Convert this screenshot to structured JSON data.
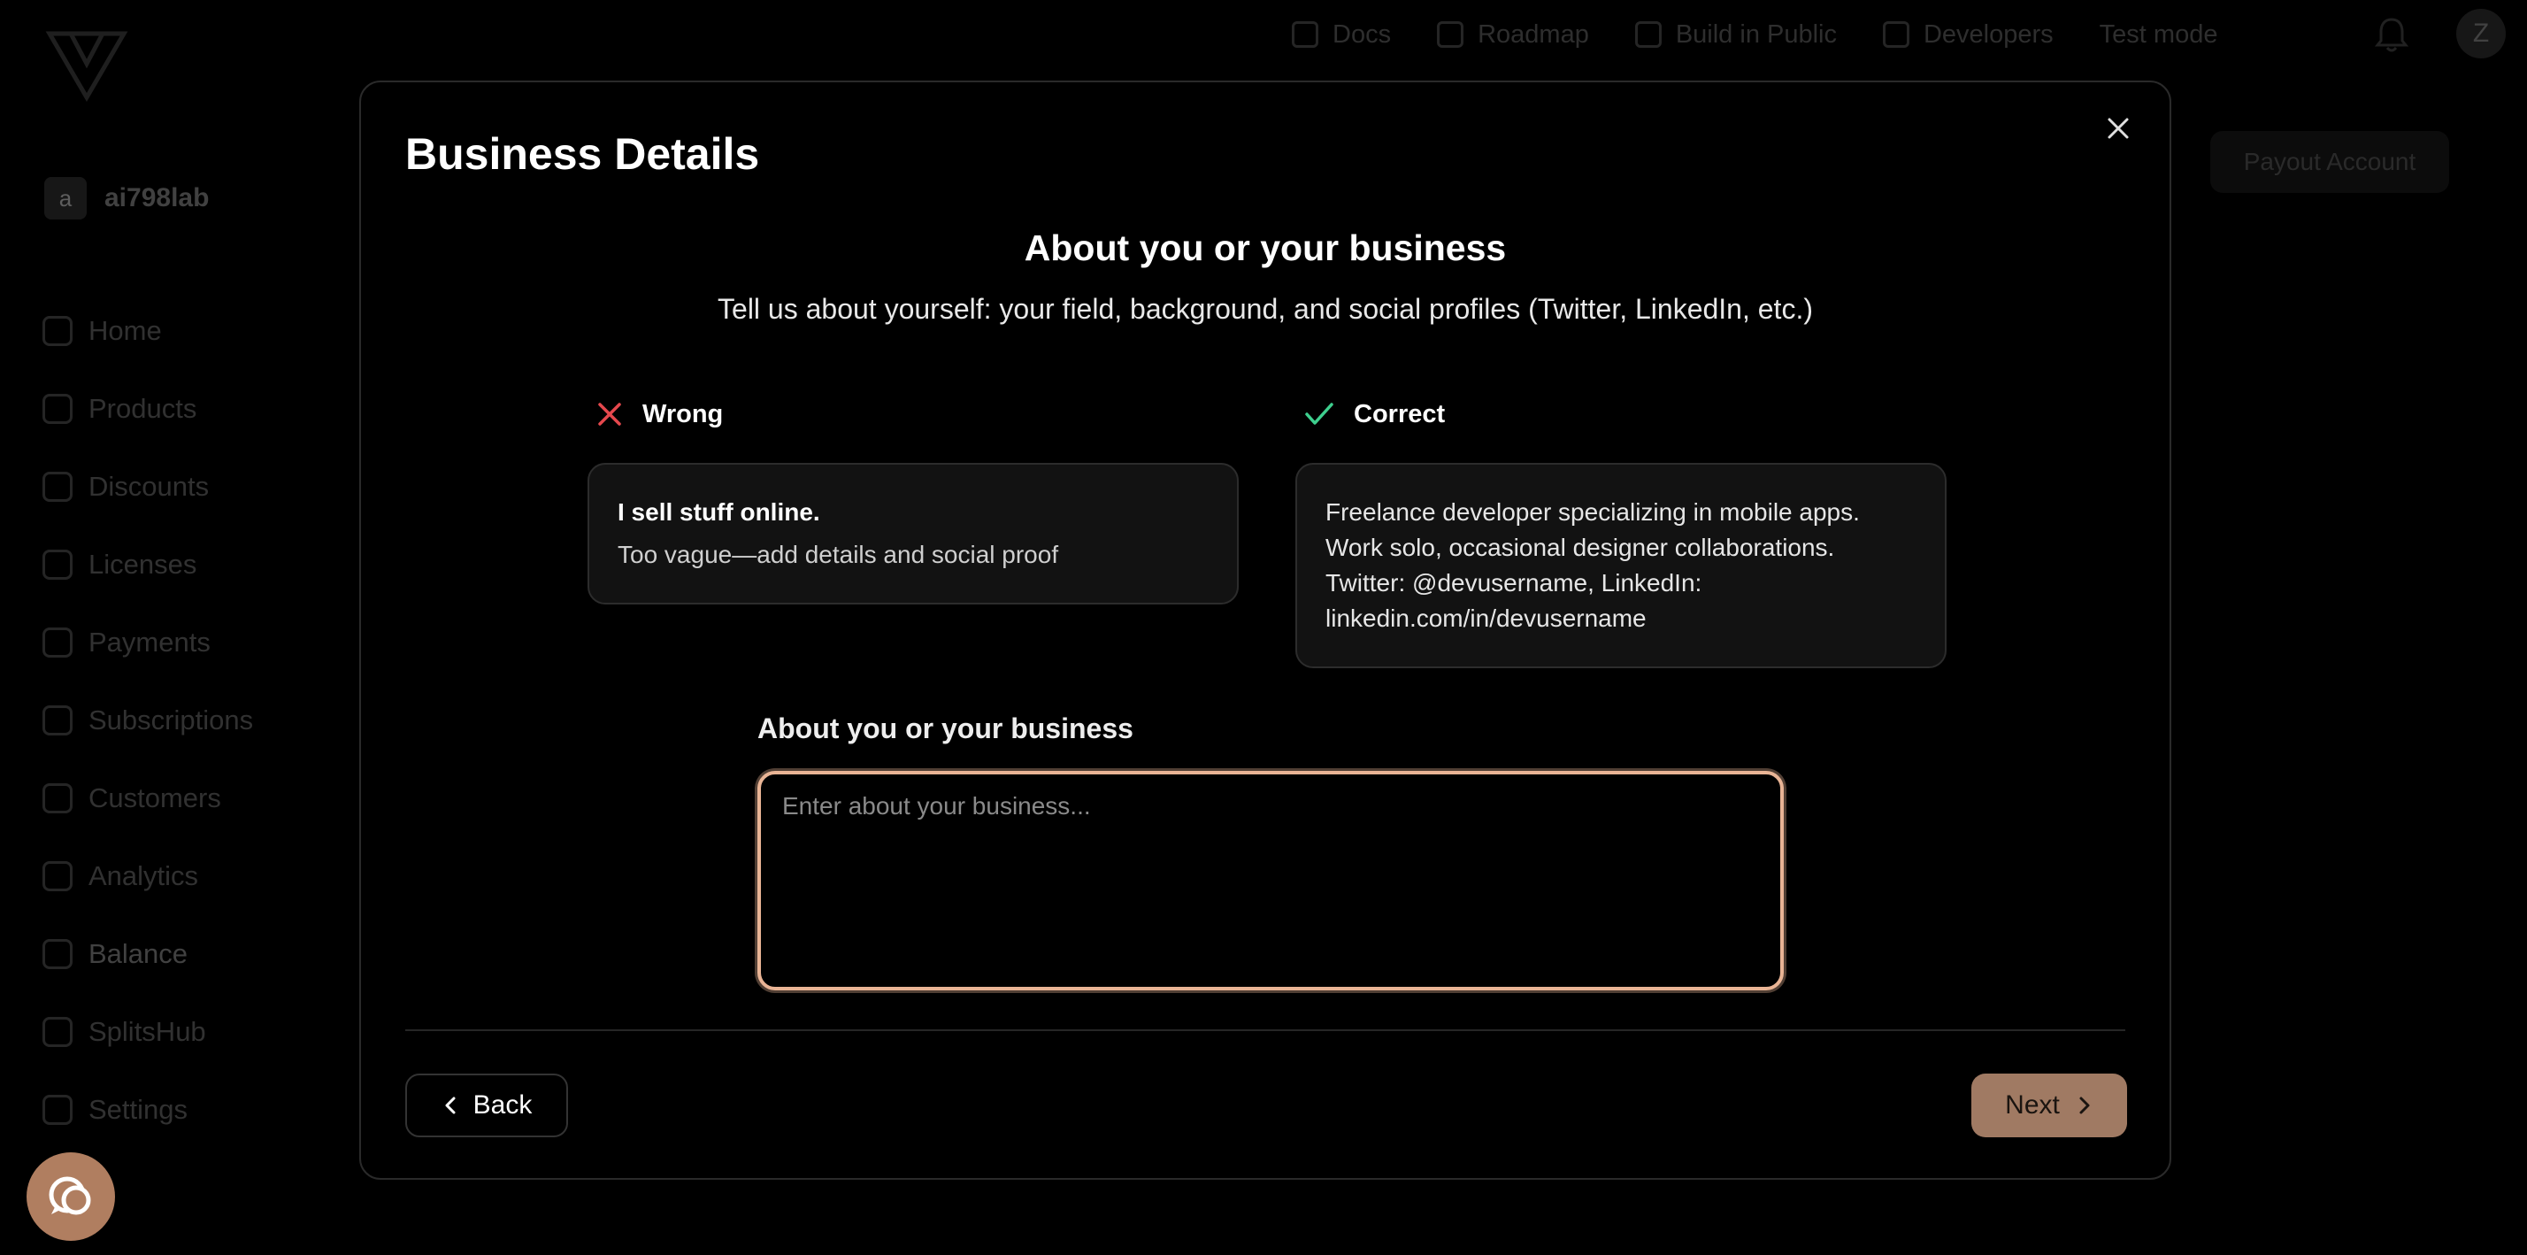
{
  "app": {
    "workspace": {
      "avatar_letter": "a",
      "name": "ai798lab"
    },
    "sidebar": {
      "items": [
        {
          "label": "Home",
          "icon": "home-icon"
        },
        {
          "label": "Products",
          "icon": "products-icon"
        },
        {
          "label": "Discounts",
          "icon": "discounts-icon"
        },
        {
          "label": "Licenses",
          "icon": "licenses-icon"
        },
        {
          "label": "Payments",
          "icon": "payments-icon"
        },
        {
          "label": "Subscriptions",
          "icon": "subscriptions-icon"
        },
        {
          "label": "Customers",
          "icon": "customers-icon"
        },
        {
          "label": "Analytics",
          "icon": "analytics-icon"
        },
        {
          "label": "Balance",
          "icon": "balance-icon"
        },
        {
          "label": "SplitsHub",
          "icon": "splitshub-icon"
        },
        {
          "label": "Settings",
          "icon": "settings-icon"
        }
      ]
    },
    "topnav": {
      "docs": "Docs",
      "roadmap": "Roadmap",
      "build_in_public": "Build in Public",
      "developers": "Developers",
      "test_mode": "Test mode"
    },
    "user_initial": "Z",
    "payout_button": "Payout Account"
  },
  "modal": {
    "title": "Business Details",
    "heading": "About you or your business",
    "subheading": "Tell us about yourself: your field, background, and social profiles (Twitter, LinkedIn, etc.)",
    "wrong": {
      "label": "Wrong",
      "title": "I sell stuff online.",
      "note": "Too vague—add details and social proof"
    },
    "correct": {
      "label": "Correct",
      "lines": [
        "Freelance developer specializing in mobile apps.",
        "Work solo, occasional designer collaborations.",
        "Twitter: @devusername, LinkedIn:",
        "linkedin.com/in/devusername"
      ]
    },
    "field_label": "About you or your business",
    "field_value": "",
    "field_placeholder": "Enter about your business...",
    "back_label": "Back",
    "next_label": "Next"
  },
  "colors": {
    "accent": "#a07a63",
    "focus_ring": "#e9b495",
    "wrong": "#e5484d",
    "correct": "#3ecf8e"
  }
}
